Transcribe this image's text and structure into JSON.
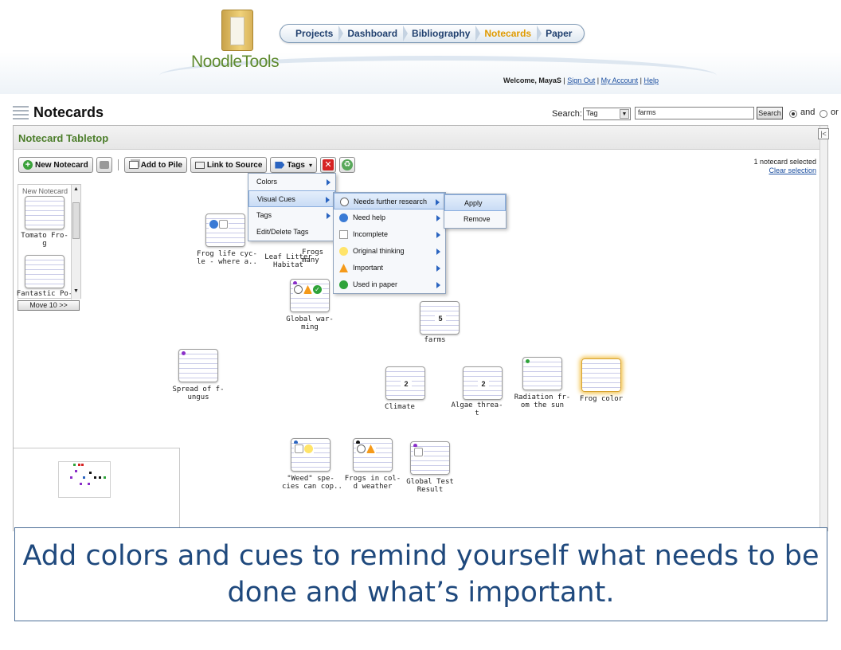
{
  "app": {
    "logo_text": "NoodleTools"
  },
  "nav": {
    "items": [
      "Projects",
      "Dashboard",
      "Bibliography",
      "Notecards",
      "Paper"
    ],
    "active": "Notecards"
  },
  "user": {
    "welcome": "Welcome, MayaS",
    "sign_out": "Sign Out",
    "my_account": "My Account",
    "help": "Help"
  },
  "page": {
    "title": "Notecards"
  },
  "search": {
    "label": "Search:",
    "field_value": "Tag",
    "query": "farms",
    "button": "Search",
    "opt_and": "and",
    "opt_or": "or",
    "selected": "and"
  },
  "tabletop": {
    "title": "Notecard Tabletop",
    "toolbar": {
      "new_notecard": "New Notecard",
      "add_to_pile": "Add to Pile",
      "link_to_source": "Link to Source",
      "tags": "Tags"
    },
    "selection": {
      "count_text": "1 notecard selected",
      "clear": "Clear selection"
    },
    "new_column": {
      "header": "New Notecard",
      "cards": [
        "Tomato Fro-\ng",
        "Fantastic Po-"
      ],
      "move_button": "Move 10 >>"
    },
    "cards": [
      {
        "label": "Frog life cyc-\nle - where a..",
        "cues": [
          "speech",
          "page"
        ]
      },
      {
        "label": "Leaf Litter\nHabitat"
      },
      {
        "label": "Frogs\nmany"
      },
      {
        "label": "Global war-\nming",
        "dot": "#8b2fc9",
        "cues": [
          "mag",
          "warn",
          "check"
        ]
      },
      {
        "label": "farms",
        "count": "5"
      },
      {
        "label": "Spread of f-\nungus",
        "dot": "#8b2fc9"
      },
      {
        "label": "Climate",
        "count": "2"
      },
      {
        "label": "Algae threa-\nt",
        "count": "2"
      },
      {
        "label": "Radiation fr-\nom the sun",
        "dot": "#2fa33a"
      },
      {
        "label": "Frog color",
        "selected": true
      },
      {
        "label": "\"Weed\" spe-\ncies can cop..",
        "dot": "#2a64c0",
        "cues": [
          "page",
          "bulb"
        ]
      },
      {
        "label": "Frogs in col-\nd weather",
        "dot": "#111111",
        "cues": [
          "mag",
          "warn"
        ]
      },
      {
        "label": "Global Test\nResult",
        "dot": "#8b2fc9",
        "cues": [
          "page"
        ]
      }
    ]
  },
  "menus": {
    "tags_menu": [
      "Colors",
      "Visual Cues",
      "Tags",
      "Edit/Delete Tags"
    ],
    "visual_cues": [
      {
        "label": "Needs further research",
        "icon": "magnifier-icon"
      },
      {
        "label": "Need help",
        "icon": "speech-bubble-icon"
      },
      {
        "label": "Incomplete",
        "icon": "blank-page-icon"
      },
      {
        "label": "Original thinking",
        "icon": "lightbulb-icon"
      },
      {
        "label": "Important",
        "icon": "warning-icon"
      },
      {
        "label": "Used in paper",
        "icon": "check-icon"
      }
    ],
    "action_menu": [
      "Apply",
      "Remove"
    ]
  },
  "caption": {
    "text": "Add colors and cues to remind yourself what needs to be done and what’s important."
  },
  "colors": {
    "accent_blue": "#1f497d",
    "nav_active": "#e09a00",
    "title_green": "#4b7d2a",
    "card_line": "#c9cbe8"
  }
}
